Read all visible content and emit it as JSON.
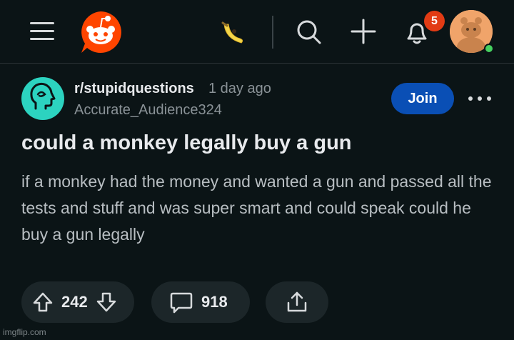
{
  "header": {
    "notification_count": "5",
    "icons": [
      "menu-icon",
      "reddit-logo-icon",
      "banana-icon",
      "search-icon",
      "plus-icon",
      "bell-icon",
      "user-avatar"
    ]
  },
  "post": {
    "subreddit": "r/stupidquestions",
    "time": "1 day ago",
    "author": "Accurate_Audience324",
    "join_label": "Join",
    "title": "could a monkey legally buy a gun",
    "body": "if a monkey had the money and wanted a gun and passed all the tests and stuff and was super smart and could speak could he buy a gun legally"
  },
  "actions": {
    "votes": "242",
    "comments": "918"
  },
  "watermark": "imgflip.com",
  "colors": {
    "background": "#0b1416",
    "join_button": "#0a4fb5",
    "badge": "#e23b14",
    "subreddit_icon": "#2cd3c0",
    "reddit_orange": "#ff4500",
    "online": "#46d160"
  }
}
